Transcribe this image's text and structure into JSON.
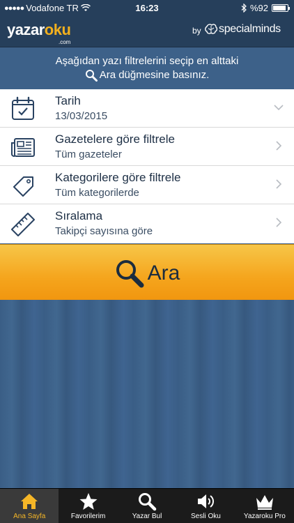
{
  "status_bar": {
    "carrier": "Vodafone TR",
    "time": "16:23",
    "battery": "%92",
    "battery_level": 0.92
  },
  "header": {
    "logo_part1": "yazar",
    "logo_part2": "oku",
    "logo_sub": ".com",
    "by_label": "by",
    "partner": "specialminds"
  },
  "instructions": {
    "line1": "Aşağıdan yazı filtrelerini seçip en alttaki",
    "line2": "Ara düğmesine basınız."
  },
  "filters": [
    {
      "title": "Tarih",
      "value": "13/03/2015",
      "icon": "calendar-icon",
      "chevron": "chevron-down-icon"
    },
    {
      "title": "Gazetelere göre filtrele",
      "value": "Tüm gazeteler",
      "icon": "newspaper-icon",
      "chevron": "chevron-right-icon"
    },
    {
      "title": "Kategorilere göre filtrele",
      "value": "Tüm kategorilerde",
      "icon": "tag-icon",
      "chevron": "chevron-right-icon"
    },
    {
      "title": "Sıralama",
      "value": "Takipçi sayısına göre",
      "icon": "ruler-icon",
      "chevron": "chevron-right-icon"
    }
  ],
  "search": {
    "label": "Ara",
    "icon": "search-icon"
  },
  "tabs": [
    {
      "label": "Ana Sayfa",
      "icon": "home-icon",
      "active": true
    },
    {
      "label": "Favorilerim",
      "icon": "star-icon",
      "active": false
    },
    {
      "label": "Yazar Bul",
      "icon": "search-icon",
      "active": false
    },
    {
      "label": "Sesli Oku",
      "icon": "speaker-icon",
      "active": false
    },
    {
      "label": "Yazaroku Pro",
      "icon": "crown-icon",
      "active": false
    }
  ],
  "colors": {
    "header_bg": "#263f5b",
    "content_bg": "#3d6189",
    "accent": "#f5a51d",
    "active_tab_label": "#f5b627"
  }
}
